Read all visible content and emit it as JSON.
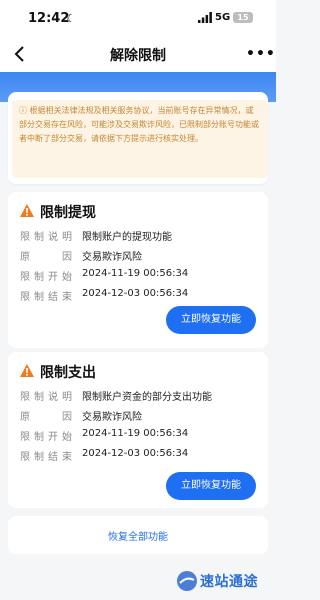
{
  "status_bar": {
    "time": "12:42",
    "network": "5G",
    "battery": "15"
  },
  "nav": {
    "title": "解除限制"
  },
  "notice": {
    "text": "ⓘ 根据相关法律法规及相关服务协议，当前账号存在异常情况，或部分交易存在风险，可能涉及交易欺诈风险，已限制部分账号功能或者中断了部分交易，请依据下方提示进行核实处理。"
  },
  "sections": [
    {
      "title": "限制提现",
      "rows": [
        {
          "label": "限制说明",
          "value": "限制账户的提现功能"
        },
        {
          "label": "原因",
          "value": "交易欺诈风险"
        },
        {
          "label": "限制开始",
          "value": "2024-11-19 00:56:34"
        },
        {
          "label": "限制结束",
          "value": "2024-12-03 00:56:34"
        }
      ],
      "button": "立即恢复功能"
    },
    {
      "title": "限制支出",
      "rows": [
        {
          "label": "限制说明",
          "value": "限制账户资金的部分支出功能"
        },
        {
          "label": "原因",
          "value": "交易欺诈风险"
        },
        {
          "label": "限制开始",
          "value": "2024-11-19 00:56:34"
        },
        {
          "label": "限制结束",
          "value": "2024-12-03 00:56:34"
        }
      ],
      "button": "立即恢复功能"
    }
  ],
  "restore_all": "恢复全部功能",
  "watermark": {
    "text": "速站通途"
  },
  "colors": {
    "accent": "#1f6ff2",
    "notice_bg": "#fdf4e6",
    "notice_text": "#c4862f",
    "warning": "#f07a1e"
  },
  "icons": [
    "back-icon",
    "more-icon",
    "info-icon",
    "warning-icon",
    "moon-icon",
    "signal-icon"
  ]
}
